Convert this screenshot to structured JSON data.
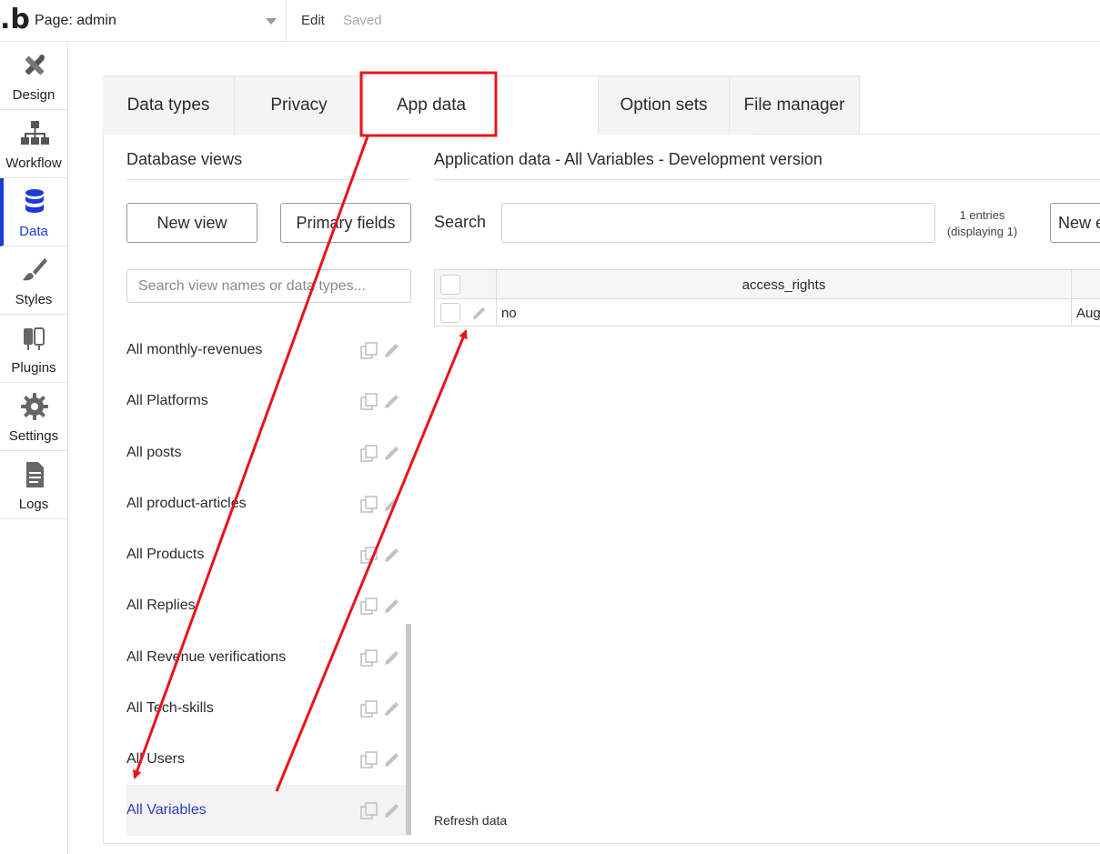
{
  "topbar": {
    "logo": ".b",
    "page_select": "Page: admin",
    "edit": "Edit",
    "saved": "Saved"
  },
  "nav": {
    "items": [
      {
        "label": "Design",
        "icon": "design-icon"
      },
      {
        "label": "Workflow",
        "icon": "workflow-icon"
      },
      {
        "label": "Data",
        "icon": "database-icon",
        "active": true
      },
      {
        "label": "Styles",
        "icon": "brush-icon"
      },
      {
        "label": "Plugins",
        "icon": "plug-icon"
      },
      {
        "label": "Settings",
        "icon": "gear-icon"
      },
      {
        "label": "Logs",
        "icon": "document-icon"
      }
    ]
  },
  "tabs": [
    {
      "label": "Data types"
    },
    {
      "label": "Privacy"
    },
    {
      "label": "App data",
      "active": true
    },
    {
      "label": "Option sets"
    },
    {
      "label": "File manager"
    }
  ],
  "left": {
    "title": "Database views",
    "new_view": "New view",
    "primary_fields": "Primary fields",
    "search_placeholder": "Search view names or data types...",
    "views": [
      "All monthly-revenues",
      "All Platforms",
      "All posts",
      "All product-articles",
      "All Products",
      "All Replies",
      "All Revenue verifications",
      "All Tech-skills",
      "All Users",
      "All Variables"
    ],
    "active_view": "All Variables"
  },
  "main": {
    "title": "Application data - All Variables - Development version",
    "search_label": "Search",
    "entries_line1": "1 entries",
    "entries_line2": "(displaying 1)",
    "new_entry": "New entry",
    "columns": [
      "access_rights"
    ],
    "rows": [
      {
        "access_rights": "no",
        "next_col": "Aug"
      }
    ],
    "refresh": "Refresh data"
  },
  "colors": {
    "accent": "#1b3bd6",
    "active_link": "#2a3fbf",
    "annotation": "#e8141b"
  }
}
